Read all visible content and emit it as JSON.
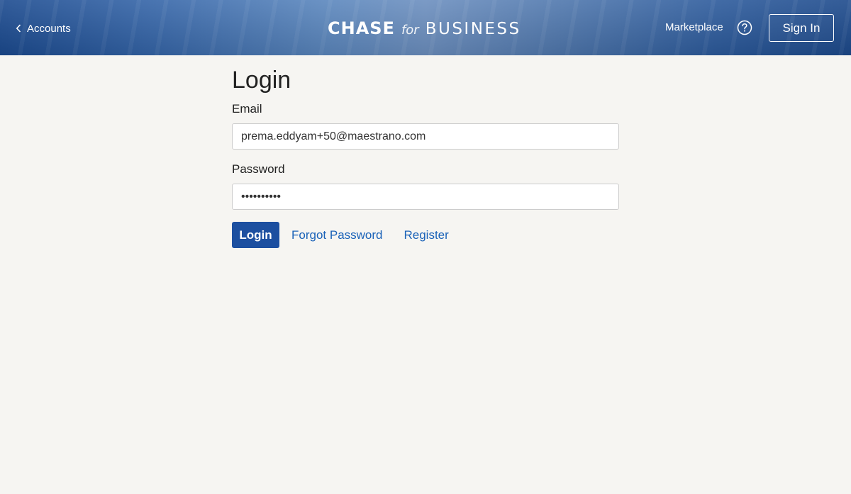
{
  "header": {
    "back_label": "Accounts",
    "logo": {
      "chase": "CHASE",
      "for": "for",
      "business": "BUSINESS"
    },
    "marketplace_label": "Marketplace",
    "help_icon": "question-circle-icon",
    "signin_label": "Sign In"
  },
  "form": {
    "title": "Login",
    "email_label": "Email",
    "email_value": "prema.eddyam+50@maestrano.com",
    "password_label": "Password",
    "password_value": "••••••••••",
    "login_label": "Login",
    "forgot_label": "Forgot Password",
    "register_label": "Register"
  },
  "colors": {
    "accent": "#1c4fa0",
    "link": "#1a62b8",
    "background": "#f6f5f2"
  }
}
